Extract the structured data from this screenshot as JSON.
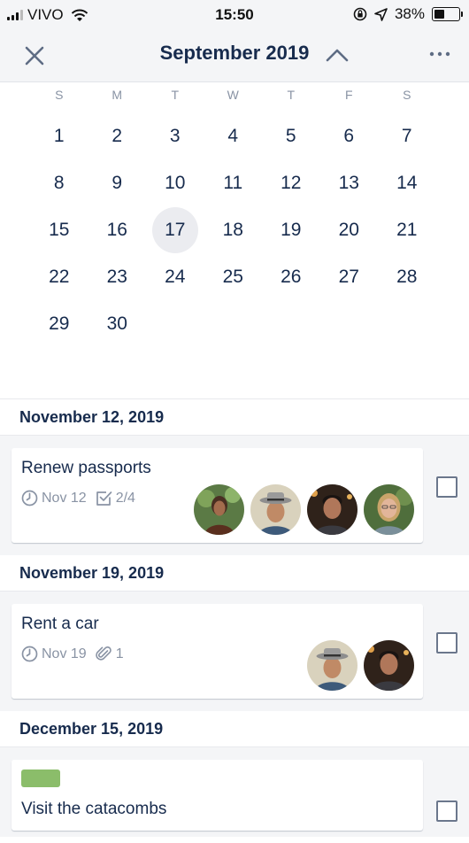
{
  "status_bar": {
    "carrier": "VIVO",
    "time": "15:50",
    "battery": "38%"
  },
  "header": {
    "title": "September 2019"
  },
  "calendar": {
    "weekdays": [
      "S",
      "M",
      "T",
      "W",
      "T",
      "F",
      "S"
    ],
    "days": [
      "1",
      "2",
      "3",
      "4",
      "5",
      "6",
      "7",
      "8",
      "9",
      "10",
      "11",
      "12",
      "13",
      "14",
      "15",
      "16",
      "17",
      "18",
      "19",
      "20",
      "21",
      "22",
      "23",
      "24",
      "25",
      "26",
      "27",
      "28",
      "29",
      "30"
    ],
    "today": "17"
  },
  "groups": [
    {
      "date": "November 12, 2019",
      "card": {
        "name": "Renew passports",
        "due": "Nov 12",
        "checklist": "2/4"
      }
    },
    {
      "date": "November 19, 2019",
      "card": {
        "name": "Rent a car",
        "due": "Nov 19",
        "attachments": "1"
      }
    },
    {
      "date": "December 15, 2019",
      "card": {
        "name": "Visit the catacombs",
        "label_color": "#8bbd6a"
      }
    }
  ],
  "icons": [
    "close-icon",
    "chevron-up-icon",
    "more-icon",
    "clock-icon",
    "checklist-icon",
    "attachment-icon"
  ],
  "colors": {
    "accent": "#172b4d",
    "muted": "#8993a4",
    "green_label": "#8bbd6a"
  }
}
